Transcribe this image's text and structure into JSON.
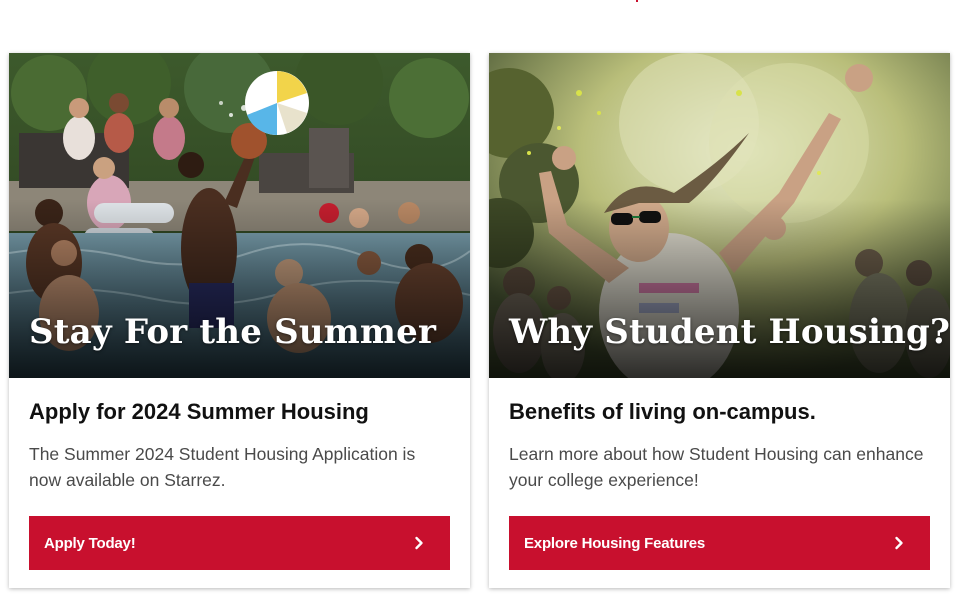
{
  "colors": {
    "accent": "#c8102e",
    "heading": "#111111",
    "body_text": "#4a4a4a",
    "overlay_text": "#ffffff"
  },
  "cards": [
    {
      "photo_title": "Stay For the Summer",
      "heading": "Apply for 2024 Summer Housing",
      "description": "The Summer 2024 Student Housing Application is now available on Starrez.",
      "button_label": "Apply Today!",
      "button_icon": "chevron-right-icon"
    },
    {
      "photo_title": "Why Student Housing?",
      "heading": "Benefits of living on-campus.",
      "description": "Learn more about how Student Housing can enhance your college experience!",
      "button_label": "Explore Housing Features",
      "button_icon": "chevron-right-icon"
    }
  ]
}
